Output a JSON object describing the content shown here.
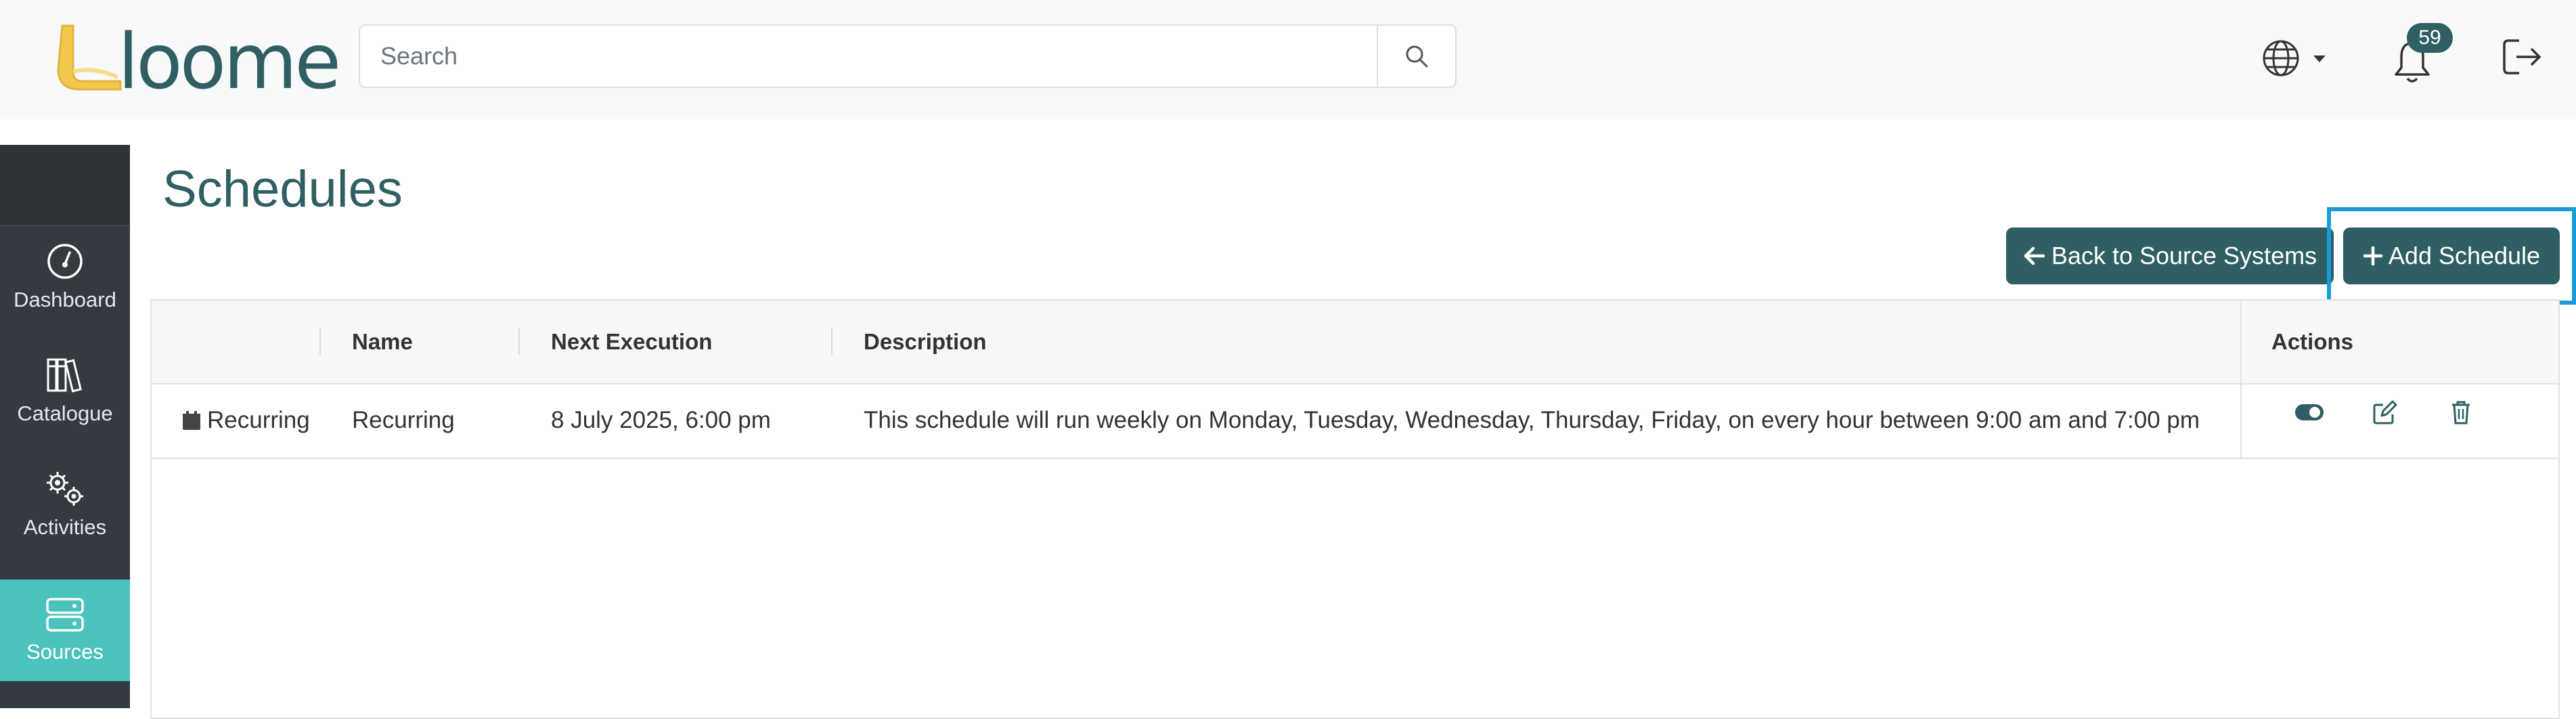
{
  "header": {
    "logo_text": "loome",
    "search": {
      "placeholder": "Search",
      "value": ""
    },
    "notifications": {
      "count": "59"
    },
    "icons": [
      "search-icon",
      "globe-icon",
      "bell-icon",
      "logout-icon"
    ]
  },
  "sidebar": {
    "items": [
      {
        "label": "Dashboard",
        "icon": "dashboard-icon",
        "active": false
      },
      {
        "label": "Catalogue",
        "icon": "books-icon",
        "active": false
      },
      {
        "label": "Activities",
        "icon": "gears-icon",
        "active": false
      },
      {
        "label": "Sources",
        "icon": "server-icon",
        "active": true
      }
    ]
  },
  "main": {
    "title": "Schedules",
    "buttons": {
      "back": "Back to Source Systems",
      "add": "Add Schedule"
    },
    "table": {
      "columns": [
        "",
        "Name",
        "Next Execution",
        "Description",
        "Actions"
      ],
      "rows": [
        {
          "type": "Recurring",
          "name": "Recurring",
          "next_execution": "8 July 2025, 6:00 pm",
          "description": "This schedule will run weekly on Monday, Tuesday, Wednesday, Thursday, Friday, on every hour between 9:00 am and 7:00 pm",
          "actions": [
            "toggle-icon",
            "edit-icon",
            "trash-icon"
          ]
        }
      ]
    }
  },
  "colors": {
    "brand": "#2f5f62",
    "sidebar": "#343a40",
    "sidebar_active": "#4bc2bd",
    "highlight": "#1a9ad6"
  }
}
